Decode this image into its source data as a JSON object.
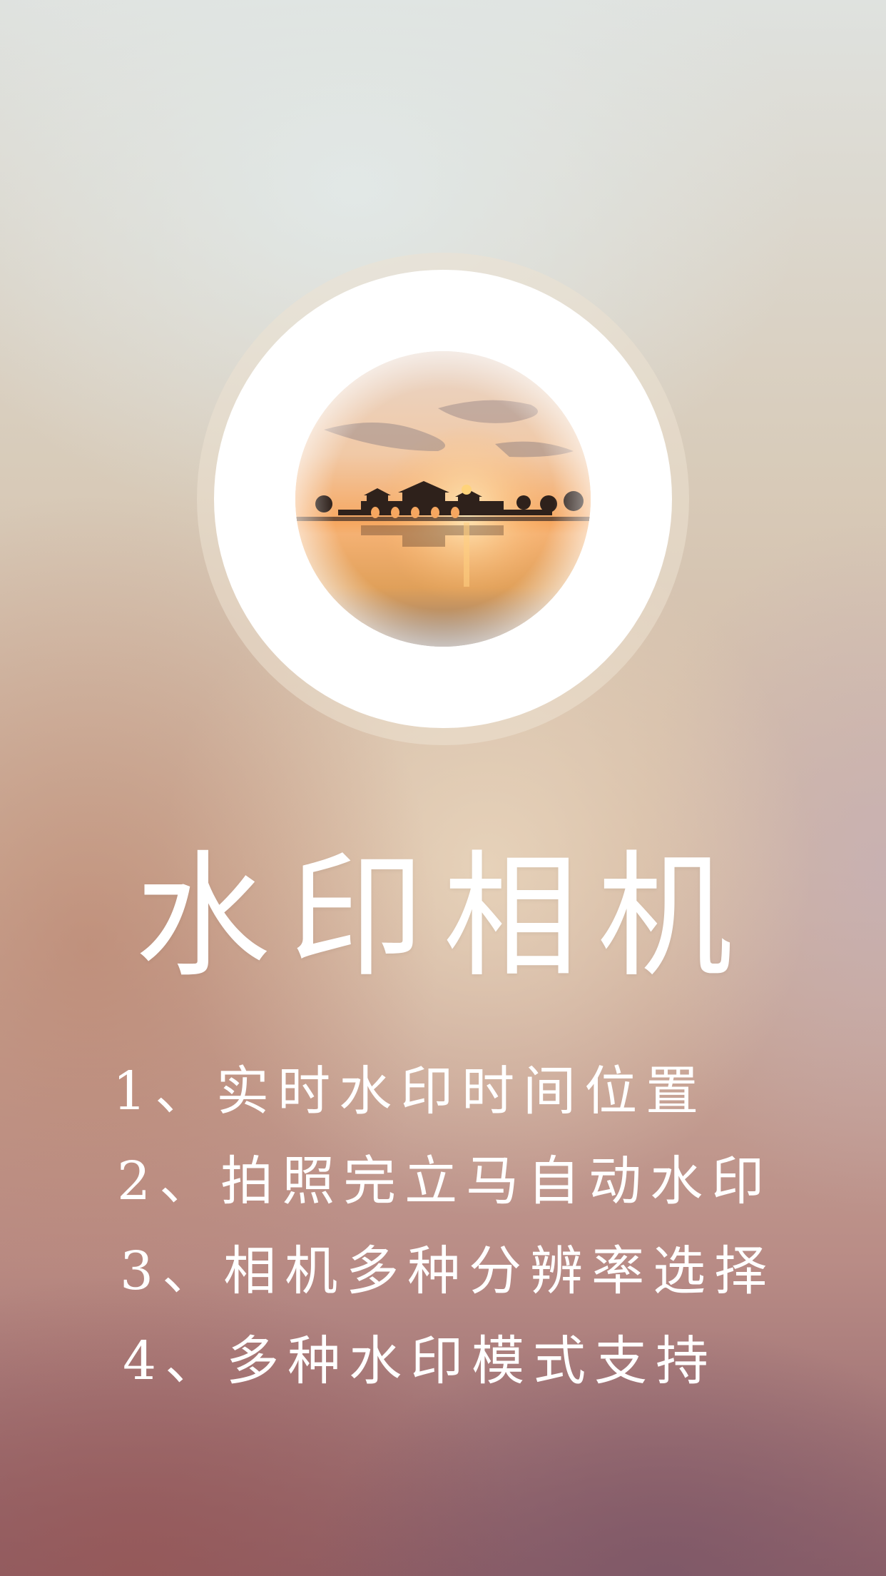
{
  "app": {
    "title": "水印相机",
    "logo_icon": "sunset-pavilion-photo-icon"
  },
  "features": [
    {
      "number": "1、",
      "text": "实时水印时间位置"
    },
    {
      "number": "2、",
      "text": "拍照完立马自动水印"
    },
    {
      "number": "3、",
      "text": "相机多种分辨率选择"
    },
    {
      "number": "4、",
      "text": "多种水印模式支持"
    }
  ],
  "colors": {
    "text": "#ffffff",
    "ring": "#ffffff",
    "background_top": "#dfe2df",
    "background_bottom": "#8e6068"
  }
}
